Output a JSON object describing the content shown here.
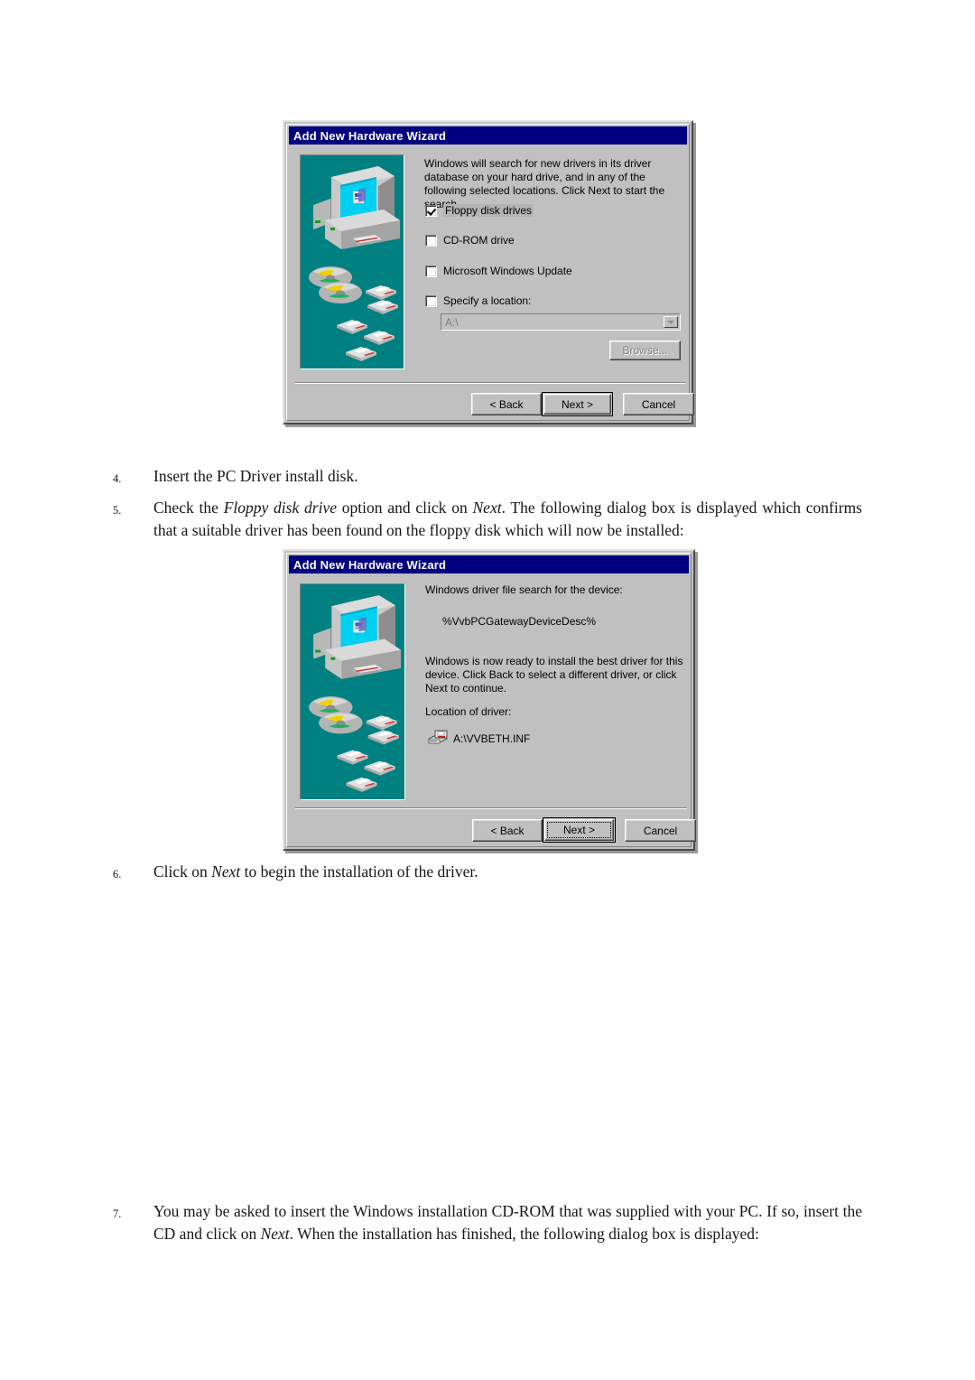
{
  "document": {
    "steps": [
      {
        "number": "4.",
        "segments": [
          {
            "text": "Insert the PC Driver install disk.",
            "style": "normal"
          }
        ]
      },
      {
        "number": "5.",
        "segments": [
          {
            "text": "Check the ",
            "style": "normal"
          },
          {
            "text": "Floppy disk drive",
            "style": "italic"
          },
          {
            "text": " option and click on ",
            "style": "normal"
          },
          {
            "text": "Next",
            "style": "italic"
          },
          {
            "text": ". The following dialog box is displayed which confirms that a suitable driver has been found on the floppy disk which will now be installed:",
            "style": "normal"
          }
        ]
      },
      {
        "number": "6.",
        "segments": [
          {
            "text": "Click on ",
            "style": "normal"
          },
          {
            "text": "Next",
            "style": "italic"
          },
          {
            "text": " to begin the installation of the driver.",
            "style": "normal"
          }
        ]
      },
      {
        "number": "7.",
        "segments": [
          {
            "text": "You may be asked to insert the Windows installation CD-ROM that was supplied with your PC. If so, insert the CD and click on ",
            "style": "normal"
          },
          {
            "text": "Next",
            "style": "italic"
          },
          {
            "text": ". When the installation has finished, the following dialog box is displayed:",
            "style": "normal"
          }
        ]
      }
    ]
  },
  "dialog1": {
    "title": "Add New Hardware Wizard",
    "description": "Windows will search for new drivers in its driver database on your hard drive, and in any of the following selected locations. Click Next to start the search.",
    "options": [
      {
        "label": "Floppy disk drives",
        "accel": "F",
        "checked": true,
        "selected": true
      },
      {
        "label": "CD-ROM drive",
        "accel": "C",
        "checked": false,
        "selected": false
      },
      {
        "label": "Microsoft Windows Update",
        "accel": "M",
        "checked": false,
        "selected": false
      },
      {
        "label": "Specify a location:",
        "accel": "l",
        "checked": false,
        "selected": false
      }
    ],
    "location_value": "A:\\",
    "browse_label": "Browse...",
    "buttons": [
      {
        "label": "< Back",
        "accel": "B",
        "default": false,
        "focus": false
      },
      {
        "label": "Next >",
        "accel": "",
        "default": true,
        "focus": false
      },
      {
        "label": "Cancel",
        "accel": "",
        "default": false,
        "focus": false
      }
    ]
  },
  "dialog2": {
    "title": "Add New Hardware Wizard",
    "heading": "Windows driver file search for the device:",
    "device_name": "%VvbPCGatewayDeviceDesc%",
    "body": "Windows is now ready to install the best driver for this device. Click Back to select a different driver, or click Next to continue.",
    "location_label": "Location of driver:",
    "driver_path": "A:\\VVBETH.INF",
    "buttons": [
      {
        "label": "< Back",
        "accel": "B",
        "default": false,
        "focus": false
      },
      {
        "label": "Next >",
        "accel": "",
        "default": true,
        "focus": true
      },
      {
        "label": "Cancel",
        "accel": "",
        "default": false,
        "focus": false
      }
    ]
  },
  "colors": {
    "titlebar": "#000080",
    "dialog_face": "#c0c0c0",
    "illustration_bg": "#008080",
    "screen": "#00d8f0"
  }
}
